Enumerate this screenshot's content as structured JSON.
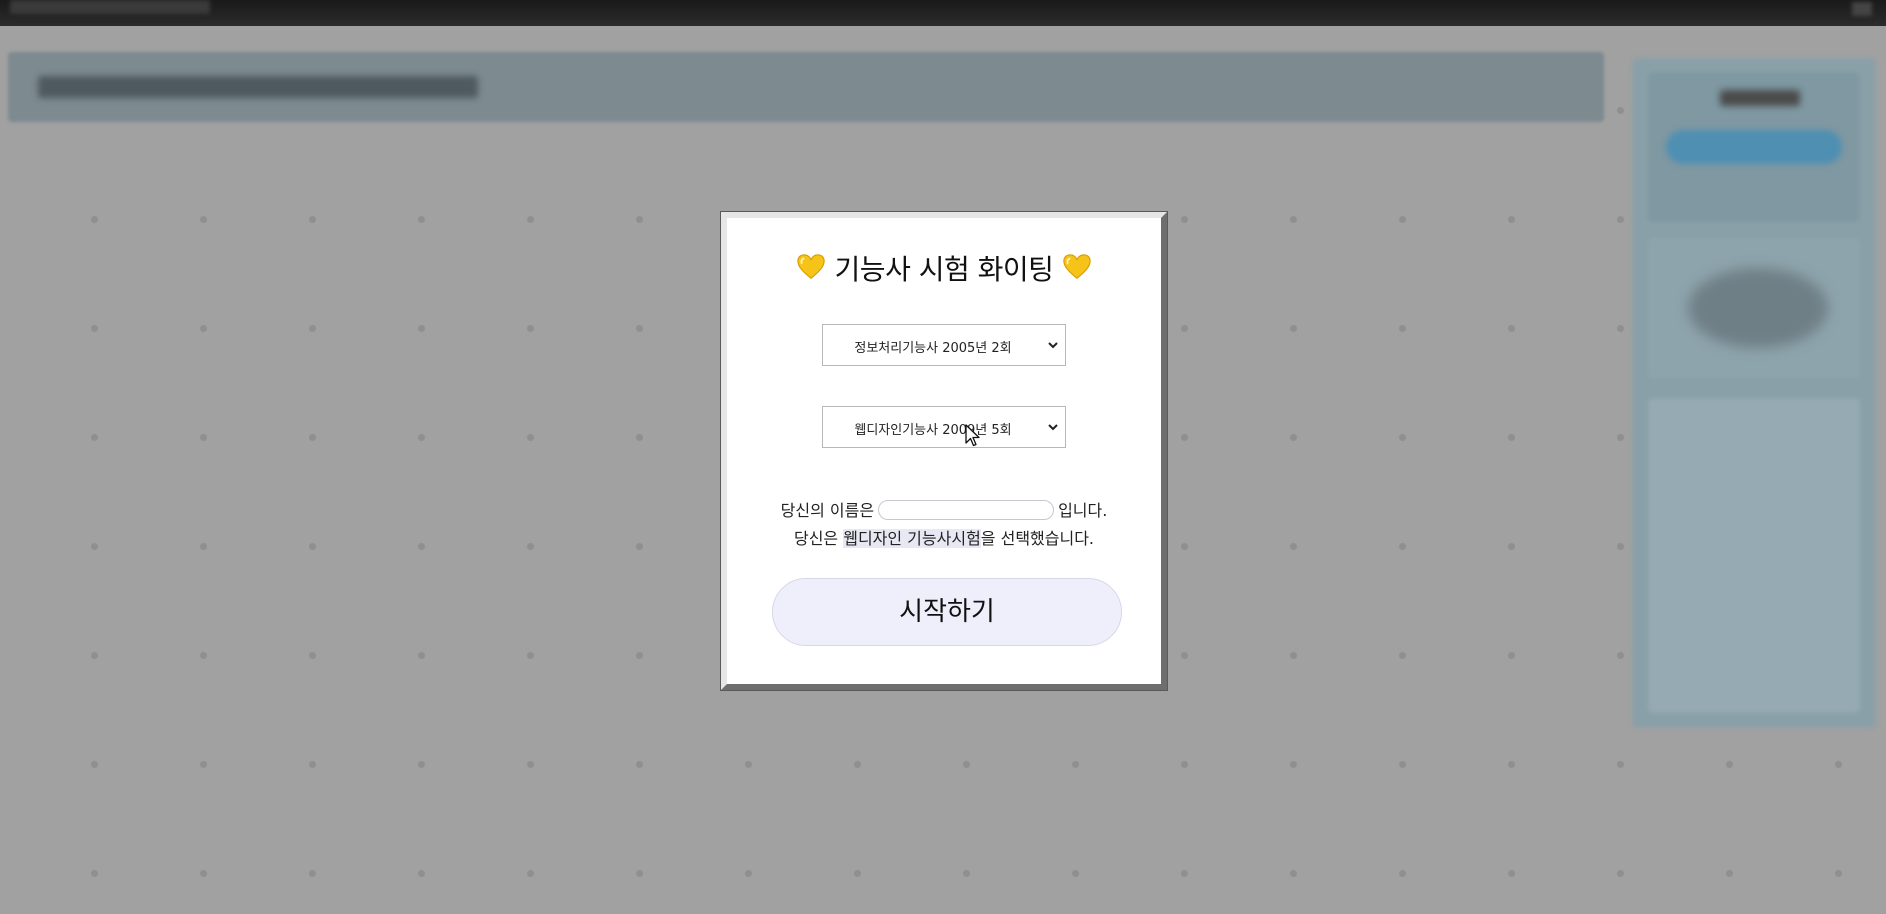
{
  "modal": {
    "title": "기능사 시험 화이팅",
    "heart_icon": "yellow-heart-icon",
    "exam_select_1": {
      "selected": "정보처리기능사 2005년 2회"
    },
    "exam_select_2": {
      "selected": "웹디자인기능사 2009년 5회"
    },
    "name_prefix": "당신의 이름은",
    "name_value": "",
    "name_suffix": "입니다.",
    "choice_prefix": "당신은 ",
    "choice_highlight": "웹디자인 기능사시험",
    "choice_suffix": "을 선택했습니다.",
    "start_button": "시작하기"
  },
  "colors": {
    "overlay": "#9a9a9a",
    "modal_bg": "#ffffff",
    "button_bg": "#efeffc",
    "heart": "#f6c318"
  }
}
